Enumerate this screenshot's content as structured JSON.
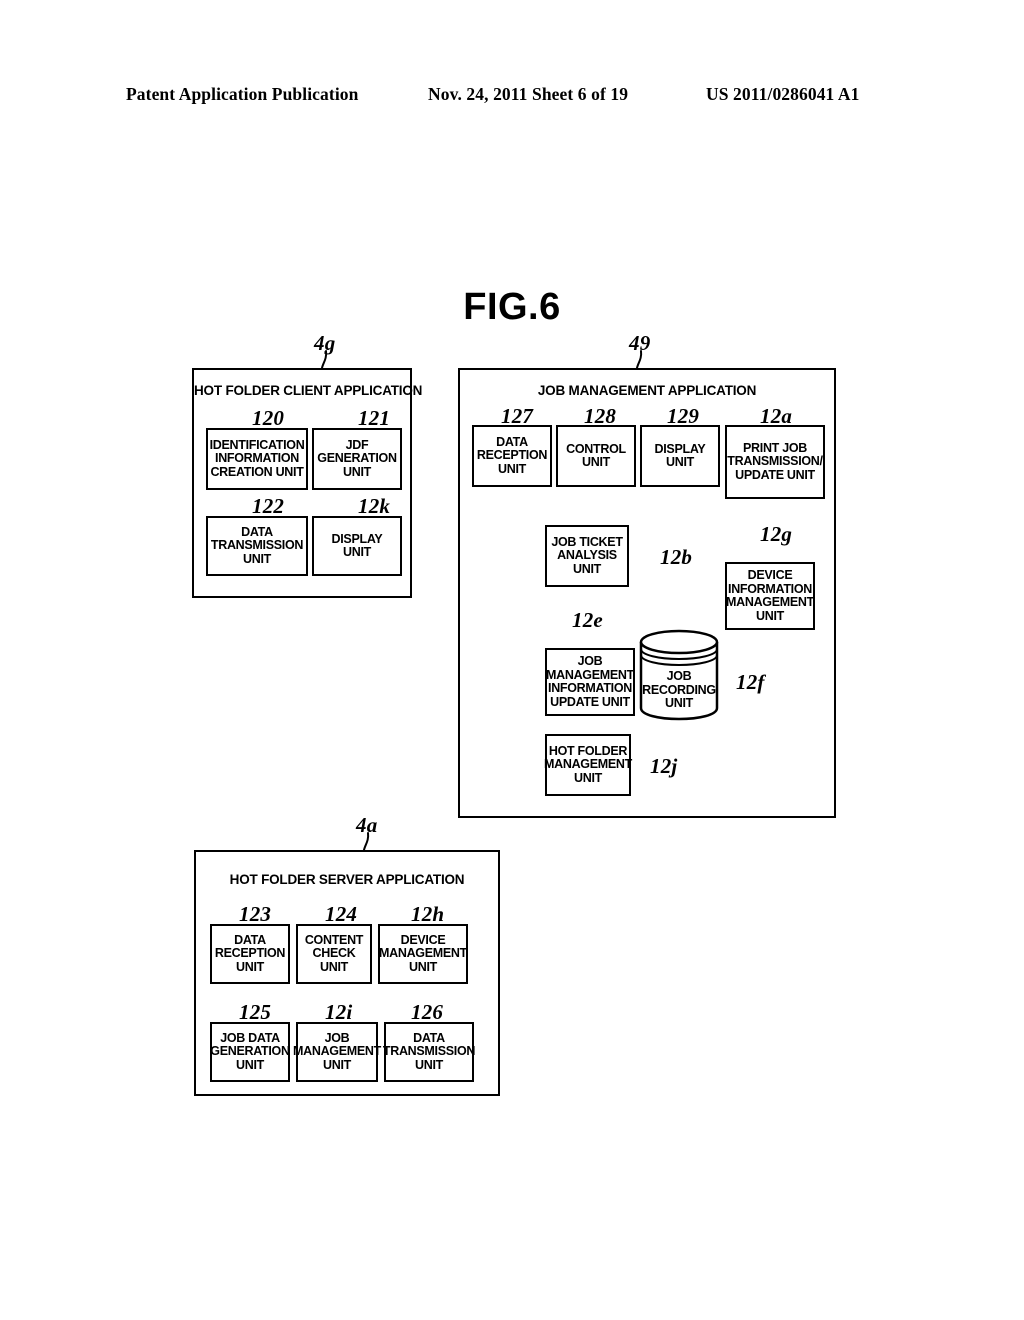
{
  "header": {
    "left": "Patent Application Publication",
    "middle": "Nov. 24, 2011  Sheet 6 of 19",
    "right": "US 2011/0286041 A1"
  },
  "figure": {
    "title": "FIG.6"
  },
  "panels": {
    "client": {
      "ref": "4g",
      "title": "HOT FOLDER CLIENT APPLICATION",
      "units": [
        {
          "ref": "120",
          "label": "IDENTIFICATION\nINFORMATION\nCREATION UNIT"
        },
        {
          "ref": "121",
          "label": "JDF\nGENERATION\nUNIT"
        },
        {
          "ref": "122",
          "label": "DATA\nTRANSMISSION\nUNIT"
        },
        {
          "ref": "12k",
          "label": "DISPLAY\nUNIT"
        }
      ]
    },
    "job_management": {
      "ref": "49",
      "title": "JOB MANAGEMENT APPLICATION",
      "units": [
        {
          "ref": "127",
          "label": "DATA\nRECEPTION\nUNIT"
        },
        {
          "ref": "128",
          "label": "CONTROL\nUNIT"
        },
        {
          "ref": "129",
          "label": "DISPLAY\nUNIT"
        },
        {
          "ref": "12a",
          "label": "PRINT JOB\nTRANSMISSION/\nUPDATE UNIT"
        },
        {
          "ref": "12b",
          "label": "JOB TICKET\nANALYSIS\nUNIT"
        },
        {
          "ref": "12g",
          "label": "DEVICE\nINFORMATION\nMANAGEMENT\nUNIT"
        },
        {
          "ref": "12e",
          "label": "JOB\nMANAGEMENT\nINFORMATION\nUPDATE UNIT"
        },
        {
          "ref": "12f",
          "label": "JOB\nRECORDING\nUNIT",
          "shape": "cylinder"
        },
        {
          "ref": "12j",
          "label": "HOT FOLDER\nMANAGEMENT\nUNIT"
        }
      ]
    },
    "server": {
      "ref": "4a",
      "title": "HOT FOLDER SERVER APPLICATION",
      "units": [
        {
          "ref": "123",
          "label": "DATA\nRECEPTION\nUNIT"
        },
        {
          "ref": "124",
          "label": "CONTENT\nCHECK UNIT"
        },
        {
          "ref": "12h",
          "label": "DEVICE\nMANAGEMENT\nUNIT"
        },
        {
          "ref": "125",
          "label": "JOB DATA\nGENERATION\nUNIT"
        },
        {
          "ref": "12i",
          "label": "JOB\nMANAGEMENT\nUNIT"
        },
        {
          "ref": "126",
          "label": "DATA\nTRANSMISSION\nUNIT"
        }
      ]
    }
  }
}
